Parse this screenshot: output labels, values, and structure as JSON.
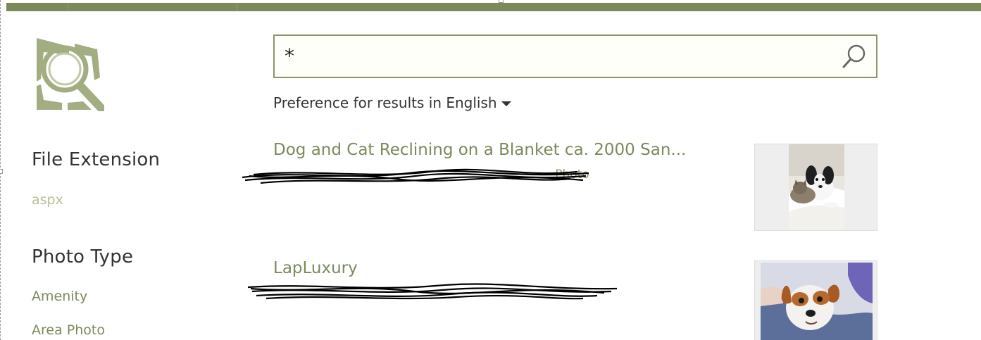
{
  "search": {
    "query": "*",
    "language_preference": "Preference for results in English"
  },
  "icons": {
    "logo": "search-magnifier-logo-icon",
    "search": "search-icon",
    "caret": "caret-down-icon"
  },
  "colors": {
    "accent": "#7b8a5a",
    "accent_light": "#b7c095",
    "text": "#333333"
  },
  "refiners": [
    {
      "title": "File Extension",
      "items": [
        "aspx"
      ]
    },
    {
      "title": "Photo Type",
      "items": [
        "Amenity",
        "Area Photo"
      ]
    }
  ],
  "results": [
    {
      "title": "Dog and Cat Reclining on a Blanket ca. 2000 San...",
      "url": "...Photo",
      "thumbnail": "dog-and-cat-photo"
    },
    {
      "title": "LapLuxury",
      "url": "",
      "thumbnail": "dog-photo"
    }
  ]
}
